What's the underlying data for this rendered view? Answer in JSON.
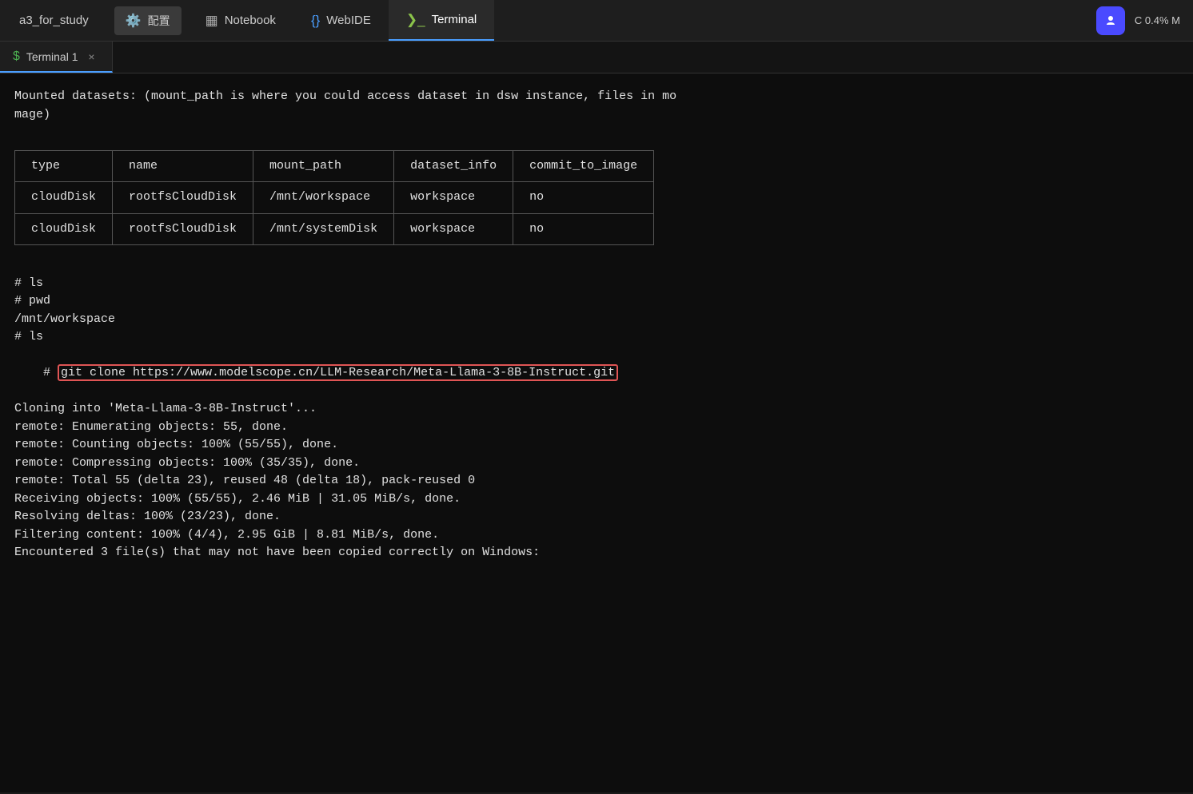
{
  "topnav": {
    "project_name": "a3_for_study",
    "config_label": "配置",
    "notebook_label": "Notebook",
    "webide_label": "WebIDE",
    "terminal_label": "Terminal",
    "status_label": "C 0.4%  M"
  },
  "terminal_tab": {
    "label": "Terminal 1",
    "close": "×"
  },
  "terminal": {
    "header_line1": "Mounted datasets: (mount_path is where you could access dataset in dsw instance, files in mo",
    "header_line2": "mage)",
    "table": {
      "headers": [
        "type",
        "name",
        "mount_path",
        "dataset_info",
        "commit_to_image"
      ],
      "rows": [
        [
          "cloudDisk",
          "rootfsCloudDisk",
          "/mnt/workspace",
          "workspace",
          "no"
        ],
        [
          "cloudDisk",
          "rootfsCloudDisk",
          "/mnt/systemDisk",
          "workspace",
          "no"
        ]
      ]
    },
    "lines": [
      "",
      "# ls",
      "# pwd",
      "/mnt/workspace",
      "# ls",
      "# git clone https://www.modelscope.cn/LLM-Research/Meta-Llama-3-8B-Instruct.git",
      "Cloning into 'Meta-Llama-3-8B-Instruct'...",
      "remote: Enumerating objects: 55, done.",
      "remote: Counting objects: 100% (55/55), done.",
      "remote: Compressing objects: 100% (35/35), done.",
      "remote: Total 55 (delta 23), reused 48 (delta 18), pack-reused 0",
      "Receiving objects: 100% (55/55), 2.46 MiB | 31.05 MiB/s, done.",
      "Resolving deltas: 100% (23/23), done.",
      "Filtering content: 100% (4/4), 2.95 GiB | 8.81 MiB/s, done.",
      "Encountered 3 file(s) that may not have been copied correctly on Windows:"
    ],
    "git_cmd_prefix": "# ",
    "git_cmd_highlighted": "git clone https://www.modelscope.cn/LLM-Research/Meta-Llama-3-8B-Instruct.git"
  }
}
